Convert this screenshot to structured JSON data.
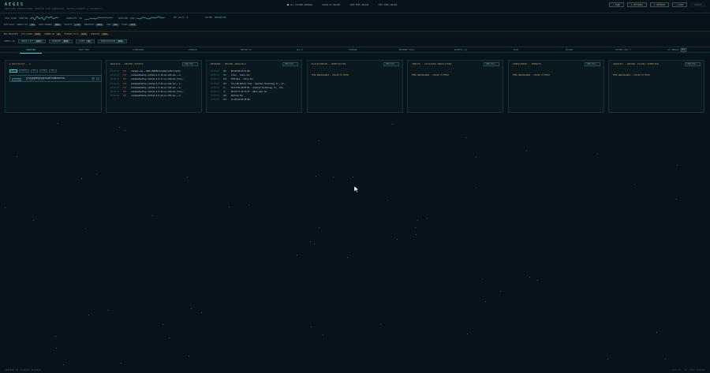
{
  "brand": {
    "name": "AEGIS",
    "subtitle": "UNIFIED OPERATIONS CENTER FOR ENDPOINT INTELLIGENCE & SECURITY"
  },
  "status": [
    "ALL SYSTEMS NOMINAL",
    "REALM 07 ONLINE",
    "SIEM FEED ONLINE",
    "CERT FEED ONLINE"
  ],
  "top_actions": [
    "⌕ FIND",
    "⚙ SETTINGS",
    "⟳ REFRESH",
    "⎋ LOCK",
    "LOGOUT"
  ],
  "metrics": [
    {
      "label": "RISK SCORE",
      "value": "326/10"
    },
    {
      "label": "ANOMALIES",
      "value": "21"
    },
    {
      "label": "BASELINE",
      "value": "23%"
    },
    {
      "label": "NET DELTA",
      "value": "4"
    },
    {
      "label": "UPTIME",
      "value": "00:00:03"
    }
  ],
  "chips1": [
    {
      "label": "AUTO-SCAN",
      "cnt": ""
    },
    {
      "label": "ROBUST-SEC",
      "cnt": "104"
    },
    {
      "label": "RULE-CHANGES",
      "cnt": "0823"
    },
    {
      "label": "PACKETS",
      "cnt": "1.2K"
    },
    {
      "label": "ENDPOINTS",
      "cnt": "0824"
    },
    {
      "label": "CONN",
      "cnt": "012"
    },
    {
      "label": "FLOWS",
      "cnt": "3232"
    }
  ],
  "chips2": [
    {
      "label": "EDR PROCESSES",
      "cnt": ""
    },
    {
      "label": "TCP_CLOSED",
      "cnt": "0828"
    },
    {
      "label": "RUNNER ON",
      "cnt": "00"
    },
    {
      "label": "NETWORK CALLS",
      "cnt": "0036"
    },
    {
      "label": "SERVICES",
      "cnt": "0804"
    }
  ],
  "chips3": [
    {
      "label": "COMMIT LOG",
      "cnt": ""
    },
    {
      "label": "ORDER'S ETF",
      "cnt": "0820"
    },
    {
      "label": "TRANSFER",
      "cnt": "0820"
    },
    {
      "label": "CLAMP",
      "cnt": "00"
    },
    {
      "label": "INVESTIGATION",
      "cnt": "0821"
    }
  ],
  "nav": [
    "OVERVIEW",
    "SELF HOST",
    "CLOUDTRAIL",
    "CONSOLE",
    "DEVICE 07",
    "DLP 8",
    "STORAGE",
    "NETWORK TOOLS",
    "PACKETS (0)",
    "PCAP",
    "VOLUME",
    "SYSTEM LOGS 1",
    "AI CONSOLE"
  ],
  "nav_count": "04",
  "panels": {
    "wallet": {
      "title": "◆ WATCHLIST · 1",
      "filters": [
        "ALL",
        "ACTIVE",
        "BTC",
        "ETH",
        "SOL"
      ],
      "badge": "BITCOIN",
      "addr": "3CTvKnR9MFD6b5SoDbJbVgEF3LdBDUSZYKiUX…",
      "sub": "BTC ADDRESS · WATCHED",
      "icons": [
        "⧉",
        "✕"
      ]
    },
    "process": {
      "title": "PROCESS · RECENT EVENTS",
      "btn": "VIEW FULL ↗",
      "rows": [
        {
          "t": "23:01:25",
          "s": "EXE",
          "v": "conhost.exe → WAVE_SERVER/Telemetry/Microsoft…"
        },
        {
          "t": "23:01:25",
          "s": "EXE",
          "v": "windowsdesktop-runtime-9.0.10-win-x64.exe → C…"
        },
        {
          "t": "23:01:24",
          "s": "EXE",
          "v": "windowsdesktop-runtime-9.0.17-win-x64.exe (Proc…"
        },
        {
          "t": "23:01:24",
          "s": "EXE",
          "v": "windowsdesktop-runtime-9.0.10-win-x64.exe → C…"
        },
        {
          "t": "23:01:23",
          "s": "EXE",
          "v": "windowsdesktop-runtime-9.0.10-win-x64.exe → C…"
        },
        {
          "t": "23:01:21",
          "s": "EXE",
          "v": "windowsdesktop-runtime-9.0.10-win-x64.exe (Proc…"
        },
        {
          "t": "23:01:20",
          "s": "EXE",
          "v": "windowsdesktop-runtime-9.0.10-win-x64.exe → C…"
        }
      ]
    },
    "network": {
      "title": "NETWORK · RECENT ARRIVALS",
      "btn": "VIEW FULL ↗",
      "rows": [
        {
          "t": "23:01:27",
          "a": "NEW",
          "v": "00:40:D0:24:5C:86"
        },
        {
          "t": "23:01:27",
          "a": "MAC",
          "v": "Vizio · Cello Inc."
        },
        {
          "t": "23:01:27",
          "a": "NEW",
          "v": "TPCP_Bus · Cello Inc."
        },
        {
          "t": "23:01:27",
          "a": "NEW",
          "v": "The LAN Before Time · Quantum Technology Co., Lt…"
        },
        {
          "t": "23:01:27",
          "a": "IP",
          "v": "00:12:5D:2D:8F:D1 · Quantum Technology Co., Ltd…"
        },
        {
          "t": "23:01:27",
          "a": "IP",
          "v": "00:10:C7:45:C5:F7 · Ware Labs Inc"
        },
        {
          "t": "23:01:27",
          "a": "NEW",
          "v": "Nothing Ear"
        },
        {
          "t": "23:01:27",
          "a": "NEW",
          "v": "2C:28:61:6F:45:80"
        }
      ]
    },
    "err1": {
      "title": "BLOCKSTREAM · REPUTATION",
      "btn": "VIEW FULL ↗",
      "msg": "FEED UNAVAILABLE — FAILED TO FETCH"
    },
    "err2": {
      "title": "CENSYS · ATTACKER INDICATORS",
      "btn": "VIEW FULL ↗",
      "msg": "FEED UNAVAILABLE — FAILED TO FETCH"
    },
    "err3": {
      "title": "THREATBOOK · THREATS",
      "btn": "VIEW FULL ↗",
      "msg": "FEED UNAVAILABLE — FAILED TO FETCH"
    },
    "err4": {
      "title": "VIRUSES · RECENT ISSUES OVERVIEW",
      "btn": "VIEW FULL ↗",
      "msg": "FEED UNAVAILABLE — FAILED TO FETCH"
    }
  },
  "footer": {
    "left": "POWERED BY DIGITAL RUNWARE",
    "right": "© AEGIS OPS · ALL RIGHTS RESERVED"
  }
}
